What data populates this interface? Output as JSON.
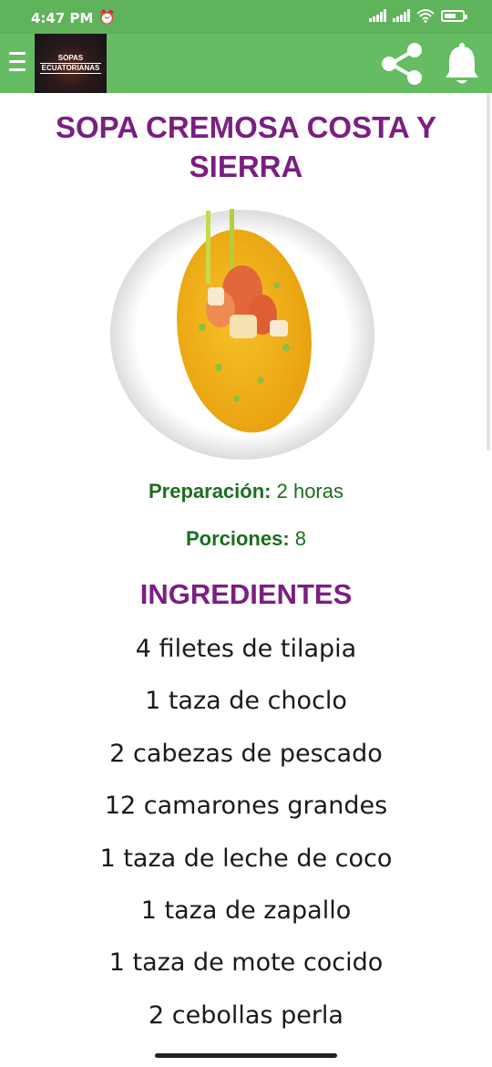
{
  "status_bar": {
    "time": "4:47 PM",
    "alarm_icon": "alarm-clock-icon",
    "signal_icon": "signal-bars-icon",
    "wifi_icon": "wifi-icon",
    "battery_icon": "battery-icon"
  },
  "app_bar": {
    "menu_icon": "hamburger-menu-icon",
    "logo_line1": "SOPAS",
    "logo_line2": "ECUATORIANAS",
    "share_icon": "share-icon",
    "bell_icon": "notification-bell-icon",
    "color": "#65bc62"
  },
  "recipe": {
    "title": "SOPA CREMOSA COSTA Y SIERRA",
    "image_alt": "soup-photo",
    "prep_label": "Preparación:",
    "prep_value": "2 horas",
    "servings_label": "Porciones:",
    "servings_value": "8",
    "ingredients_title": "INGREDIENTES",
    "ingredients": [
      "4 filetes de tilapia",
      "1 taza de choclo",
      "2 cabezas de pescado",
      "12 camarones grandes",
      "1 taza de leche de coco",
      "1 taza de zapallo",
      "1 taza de mote cocido",
      "2 cebollas perla"
    ],
    "title_color": "#7a1f82",
    "meta_color": "#1b6e1e"
  }
}
